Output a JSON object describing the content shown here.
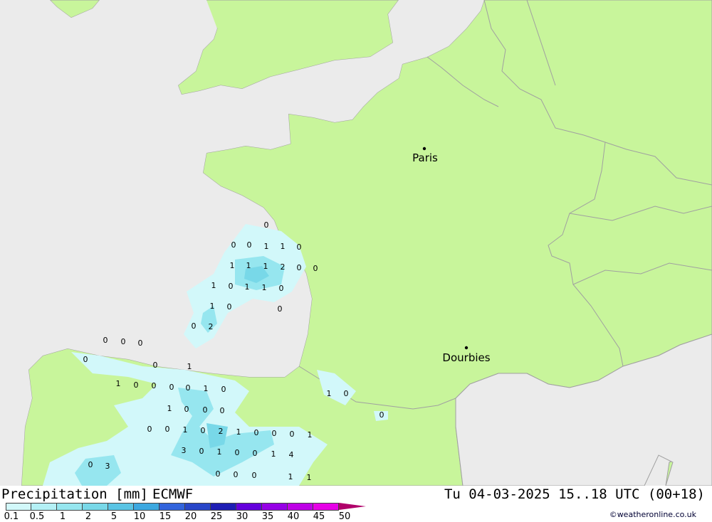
{
  "legend": {
    "title": "Precipitation [mm]",
    "model": "ECMWF",
    "datetime": "Tu 04-03-2025 15..18 UTC (00+18)",
    "credit": "©weatheronline.co.uk",
    "scale_labels": [
      "0.1",
      "0.5",
      "1",
      "2",
      "5",
      "10",
      "15",
      "20",
      "25",
      "30",
      "35",
      "40",
      "45",
      "50"
    ],
    "scale_colors": [
      "#d2f8fa",
      "#b4f0f5",
      "#96e6ef",
      "#78d8e8",
      "#5ac4e4",
      "#3ca8e0",
      "#3264dc",
      "#2846c8",
      "#1e1eb4",
      "#6400dc",
      "#9600e6",
      "#be00e6",
      "#e600e6",
      "#c800a0"
    ]
  },
  "colors": {
    "sea": "#ebebeb",
    "land": "#c8f59b",
    "border": "#a0a0a0",
    "precip_light": "#d2f8fa",
    "precip_mid": "#96e6ef",
    "precip_heavy": "#5ac4e4"
  },
  "cities": [
    {
      "name": "Paris"
    },
    {
      "name": "Dourbies"
    }
  ],
  "cell_values": [
    "0",
    "0",
    "0",
    "1",
    "1",
    "0",
    "1",
    "1",
    "1",
    "2",
    "0",
    "0",
    "1",
    "0",
    "1",
    "1",
    "0",
    "1",
    "0",
    "0",
    "2",
    "0",
    "0",
    "0",
    "0",
    "0",
    "0",
    "1",
    "0",
    "0",
    "0",
    "1",
    "0",
    "1",
    "0",
    "1",
    "0",
    "1",
    "0",
    "0",
    "0",
    "0",
    "0",
    "0",
    "1",
    "0",
    "2",
    "1",
    "0",
    "0",
    "0",
    "1",
    "3",
    "0",
    "1",
    "0",
    "0",
    "1",
    "4",
    "0",
    "3",
    "0",
    "0",
    "0",
    "1",
    "1"
  ]
}
